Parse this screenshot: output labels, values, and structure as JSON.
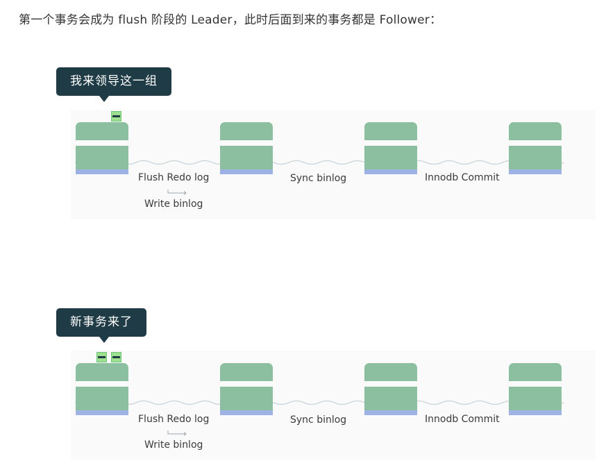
{
  "intro_text": "第一个事务会成为 flush 阶段的 Leader，此时后面到来的事务都是 Follower：",
  "diagrams": [
    {
      "bubble": "我来领导这一组",
      "stage_labels": [
        "Flush Redo log",
        "Sync binlog",
        "Innodb Commit"
      ],
      "sub_label": "Write binlog",
      "transactions": 1
    },
    {
      "bubble": "新事务来了",
      "stage_labels": [
        "Flush Redo log",
        "Sync binlog",
        "Innodb Commit"
      ],
      "sub_label": "Write binlog",
      "transactions": 2
    }
  ],
  "colors": {
    "block": "#8bbf9f",
    "block_base": "#9fb2e6",
    "bubble_bg": "#1f3b46",
    "token": "#9ee08f"
  }
}
